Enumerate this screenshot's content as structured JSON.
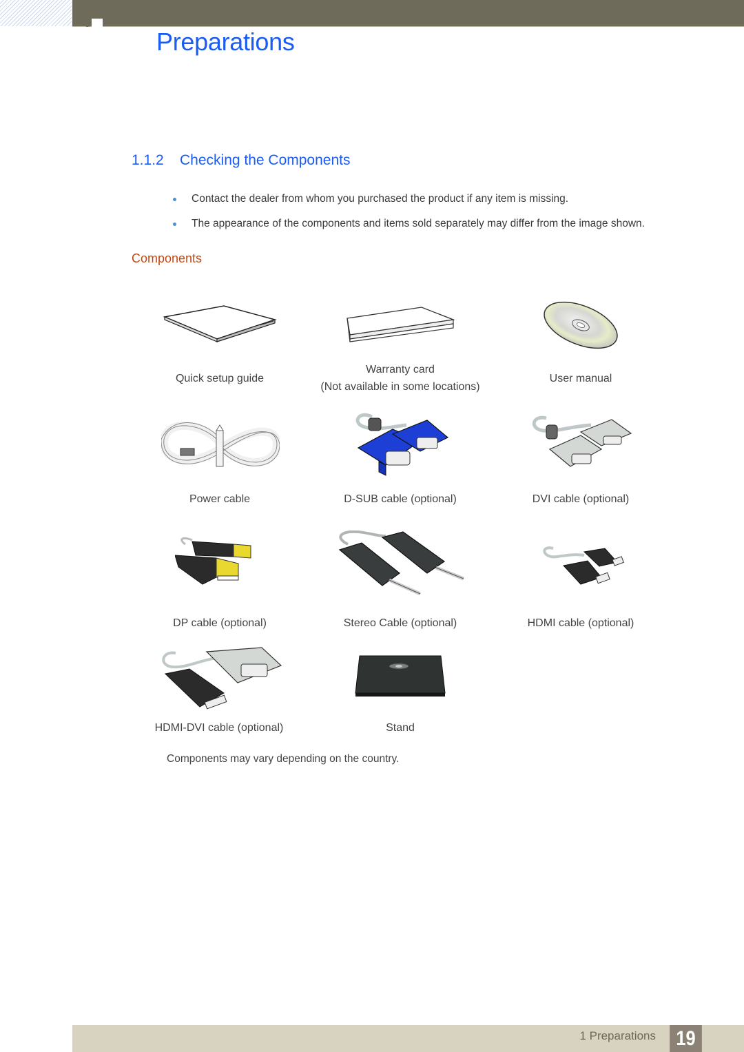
{
  "header": {
    "chapter_title": "Preparations",
    "colors": {
      "bar": "#6e6b5a",
      "title": "#1a5cf3"
    }
  },
  "section": {
    "number": "1.1.2",
    "title": "Checking the Components",
    "bullets": [
      "Contact the dealer from whom you purchased the product if any item is missing.",
      "The appearance of the components and items sold separately may differ from the image shown."
    ],
    "subsection_title": "Components",
    "subsection_color": "#c44a12"
  },
  "components": [
    {
      "icon": "booklet-icon",
      "label": "Quick setup guide"
    },
    {
      "icon": "warranty-card-icon",
      "label": "Warranty card",
      "label2": "(Not available in some locations)"
    },
    {
      "icon": "cd-disc-icon",
      "label": "User manual"
    },
    {
      "icon": "power-cable-icon",
      "label": "Power cable"
    },
    {
      "icon": "dsub-cable-icon",
      "label": "D-SUB cable (optional)"
    },
    {
      "icon": "dvi-cable-icon",
      "label": "DVI cable (optional)"
    },
    {
      "icon": "dp-cable-icon",
      "label": "DP cable (optional)"
    },
    {
      "icon": "stereo-cable-icon",
      "label": "Stereo Cable (optional)"
    },
    {
      "icon": "hdmi-cable-icon",
      "label": "HDMI cable (optional)"
    },
    {
      "icon": "hdmi-dvi-cable-icon",
      "label": "HDMI-DVI cable (optional)"
    },
    {
      "icon": "stand-icon",
      "label": "Stand"
    }
  ],
  "note": "Components may vary depending on the country.",
  "footer": {
    "chapter_label": "1 Preparations",
    "page_number": "19"
  }
}
